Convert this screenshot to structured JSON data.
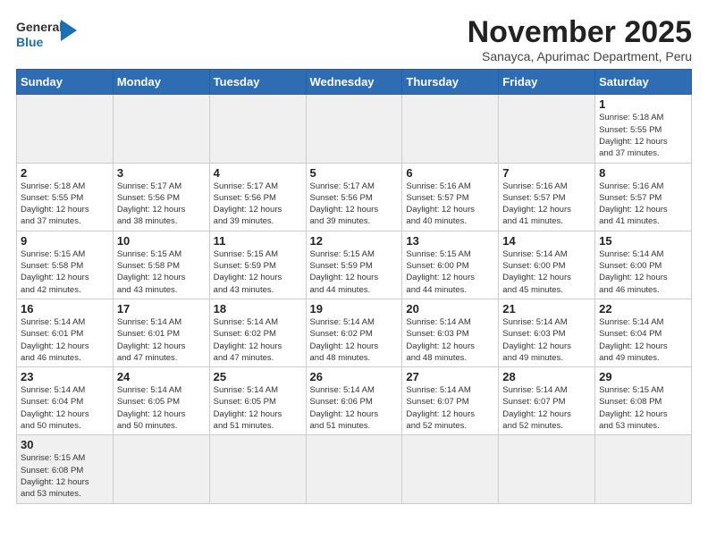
{
  "logo": {
    "general": "General",
    "blue": "Blue"
  },
  "title": "November 2025",
  "subtitle": "Sanayca, Apurimac Department, Peru",
  "weekdays": [
    "Sunday",
    "Monday",
    "Tuesday",
    "Wednesday",
    "Thursday",
    "Friday",
    "Saturday"
  ],
  "weeks": [
    [
      {
        "day": "",
        "info": ""
      },
      {
        "day": "",
        "info": ""
      },
      {
        "day": "",
        "info": ""
      },
      {
        "day": "",
        "info": ""
      },
      {
        "day": "",
        "info": ""
      },
      {
        "day": "",
        "info": ""
      },
      {
        "day": "1",
        "info": "Sunrise: 5:18 AM\nSunset: 5:55 PM\nDaylight: 12 hours\nand 37 minutes."
      }
    ],
    [
      {
        "day": "2",
        "info": "Sunrise: 5:18 AM\nSunset: 5:55 PM\nDaylight: 12 hours\nand 37 minutes."
      },
      {
        "day": "3",
        "info": "Sunrise: 5:17 AM\nSunset: 5:56 PM\nDaylight: 12 hours\nand 38 minutes."
      },
      {
        "day": "4",
        "info": "Sunrise: 5:17 AM\nSunset: 5:56 PM\nDaylight: 12 hours\nand 39 minutes."
      },
      {
        "day": "5",
        "info": "Sunrise: 5:17 AM\nSunset: 5:56 PM\nDaylight: 12 hours\nand 39 minutes."
      },
      {
        "day": "6",
        "info": "Sunrise: 5:16 AM\nSunset: 5:57 PM\nDaylight: 12 hours\nand 40 minutes."
      },
      {
        "day": "7",
        "info": "Sunrise: 5:16 AM\nSunset: 5:57 PM\nDaylight: 12 hours\nand 41 minutes."
      },
      {
        "day": "8",
        "info": "Sunrise: 5:16 AM\nSunset: 5:57 PM\nDaylight: 12 hours\nand 41 minutes."
      }
    ],
    [
      {
        "day": "9",
        "info": "Sunrise: 5:15 AM\nSunset: 5:58 PM\nDaylight: 12 hours\nand 42 minutes."
      },
      {
        "day": "10",
        "info": "Sunrise: 5:15 AM\nSunset: 5:58 PM\nDaylight: 12 hours\nand 43 minutes."
      },
      {
        "day": "11",
        "info": "Sunrise: 5:15 AM\nSunset: 5:59 PM\nDaylight: 12 hours\nand 43 minutes."
      },
      {
        "day": "12",
        "info": "Sunrise: 5:15 AM\nSunset: 5:59 PM\nDaylight: 12 hours\nand 44 minutes."
      },
      {
        "day": "13",
        "info": "Sunrise: 5:15 AM\nSunset: 6:00 PM\nDaylight: 12 hours\nand 44 minutes."
      },
      {
        "day": "14",
        "info": "Sunrise: 5:14 AM\nSunset: 6:00 PM\nDaylight: 12 hours\nand 45 minutes."
      },
      {
        "day": "15",
        "info": "Sunrise: 5:14 AM\nSunset: 6:00 PM\nDaylight: 12 hours\nand 46 minutes."
      }
    ],
    [
      {
        "day": "16",
        "info": "Sunrise: 5:14 AM\nSunset: 6:01 PM\nDaylight: 12 hours\nand 46 minutes."
      },
      {
        "day": "17",
        "info": "Sunrise: 5:14 AM\nSunset: 6:01 PM\nDaylight: 12 hours\nand 47 minutes."
      },
      {
        "day": "18",
        "info": "Sunrise: 5:14 AM\nSunset: 6:02 PM\nDaylight: 12 hours\nand 47 minutes."
      },
      {
        "day": "19",
        "info": "Sunrise: 5:14 AM\nSunset: 6:02 PM\nDaylight: 12 hours\nand 48 minutes."
      },
      {
        "day": "20",
        "info": "Sunrise: 5:14 AM\nSunset: 6:03 PM\nDaylight: 12 hours\nand 48 minutes."
      },
      {
        "day": "21",
        "info": "Sunrise: 5:14 AM\nSunset: 6:03 PM\nDaylight: 12 hours\nand 49 minutes."
      },
      {
        "day": "22",
        "info": "Sunrise: 5:14 AM\nSunset: 6:04 PM\nDaylight: 12 hours\nand 49 minutes."
      }
    ],
    [
      {
        "day": "23",
        "info": "Sunrise: 5:14 AM\nSunset: 6:04 PM\nDaylight: 12 hours\nand 50 minutes."
      },
      {
        "day": "24",
        "info": "Sunrise: 5:14 AM\nSunset: 6:05 PM\nDaylight: 12 hours\nand 50 minutes."
      },
      {
        "day": "25",
        "info": "Sunrise: 5:14 AM\nSunset: 6:05 PM\nDaylight: 12 hours\nand 51 minutes."
      },
      {
        "day": "26",
        "info": "Sunrise: 5:14 AM\nSunset: 6:06 PM\nDaylight: 12 hours\nand 51 minutes."
      },
      {
        "day": "27",
        "info": "Sunrise: 5:14 AM\nSunset: 6:07 PM\nDaylight: 12 hours\nand 52 minutes."
      },
      {
        "day": "28",
        "info": "Sunrise: 5:14 AM\nSunset: 6:07 PM\nDaylight: 12 hours\nand 52 minutes."
      },
      {
        "day": "29",
        "info": "Sunrise: 5:15 AM\nSunset: 6:08 PM\nDaylight: 12 hours\nand 53 minutes."
      }
    ],
    [
      {
        "day": "30",
        "info": "Sunrise: 5:15 AM\nSunset: 6:08 PM\nDaylight: 12 hours\nand 53 minutes."
      },
      {
        "day": "",
        "info": ""
      },
      {
        "day": "",
        "info": ""
      },
      {
        "day": "",
        "info": ""
      },
      {
        "day": "",
        "info": ""
      },
      {
        "day": "",
        "info": ""
      },
      {
        "day": "",
        "info": ""
      }
    ]
  ]
}
